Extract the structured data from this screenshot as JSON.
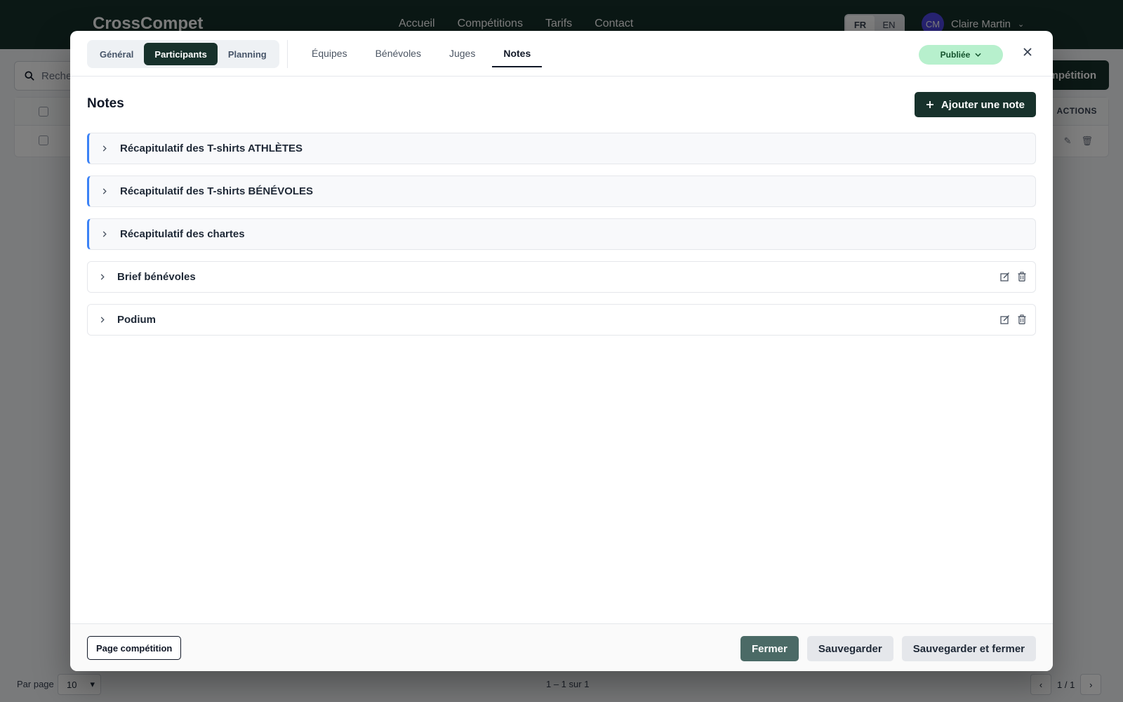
{
  "app": {
    "brand": "CrossCompet",
    "nav": [
      "Accueil",
      "Compétitions",
      "Tarifs",
      "Contact"
    ],
    "languages": [
      {
        "code": "FR",
        "active": true
      },
      {
        "code": "EN",
        "active": false
      }
    ],
    "user": {
      "initials": "CM",
      "name": "Claire Martin"
    },
    "search_placeholder": "Recher",
    "new_button": "mpétition",
    "table_actions_header": "ACTIONS",
    "pagination": {
      "per_page_label": "Par page",
      "per_page_value": "10",
      "range": "1 – 1 sur 1",
      "page": "1 / 1"
    }
  },
  "modal": {
    "segments": [
      {
        "label": "Général",
        "active": false
      },
      {
        "label": "Participants",
        "active": true
      },
      {
        "label": "Planning",
        "active": false
      }
    ],
    "tabs": [
      {
        "label": "Équipes",
        "active": false
      },
      {
        "label": "Bénévoles",
        "active": false
      },
      {
        "label": "Juges",
        "active": false
      },
      {
        "label": "Notes",
        "active": true
      }
    ],
    "status": "Publiée",
    "colors": {
      "primary": "#17312b",
      "accent": "#3b82f6",
      "status_bg": "#b7f0cd"
    },
    "section": {
      "title": "Notes",
      "add_button": "Ajouter une note"
    },
    "notes": [
      {
        "title": "Récapitulatif des T-shirts ATHLÈTES",
        "pinned": true
      },
      {
        "title": "Récapitulatif des T-shirts BÉNÉVOLES",
        "pinned": true
      },
      {
        "title": "Récapitulatif des chartes",
        "pinned": true
      },
      {
        "title": "Brief bénévoles",
        "pinned": false
      },
      {
        "title": "Podium",
        "pinned": false
      }
    ],
    "footer": {
      "page_button": "Page compétition",
      "close": "Fermer",
      "save": "Sauvegarder",
      "save_close": "Sauvegarder et fermer"
    }
  }
}
